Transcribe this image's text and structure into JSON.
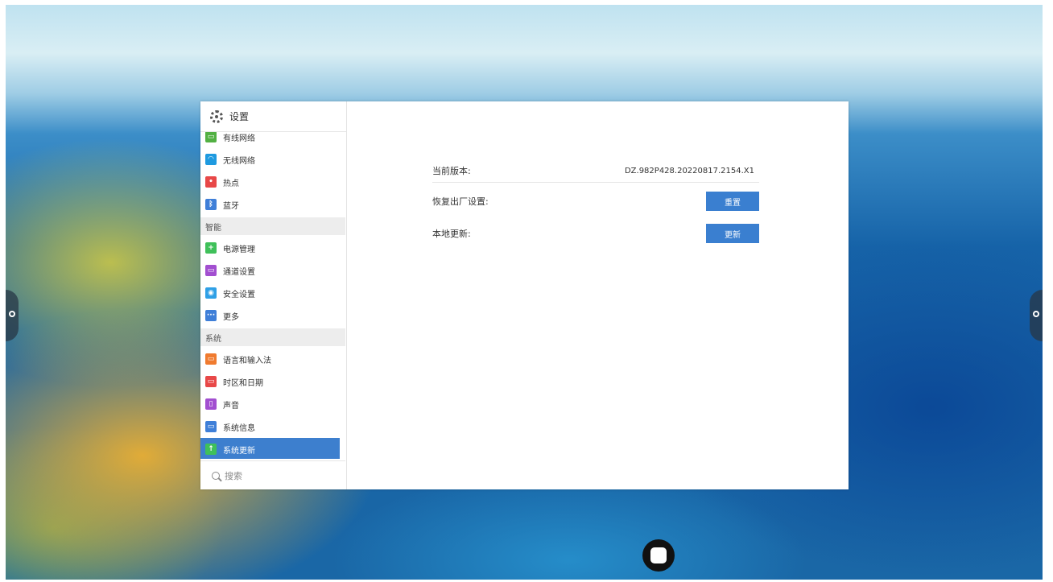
{
  "app": {
    "title": "设置"
  },
  "sidebar": {
    "items_top": [
      {
        "label": "有线网络",
        "icon": "wired-network-icon",
        "color": "#52b043",
        "glyph": "▭"
      },
      {
        "label": "无线网络",
        "icon": "wifi-icon",
        "color": "#1e9ae0",
        "glyph": "◠"
      },
      {
        "label": "热点",
        "icon": "hotspot-icon",
        "color": "#e84848",
        "glyph": "•"
      },
      {
        "label": "蓝牙",
        "icon": "bluetooth-icon",
        "color": "#3f7fd8",
        "glyph": "ᛒ"
      }
    ],
    "section_smart": "智能",
    "items_smart": [
      {
        "label": "电源管理",
        "icon": "power-management-icon",
        "color": "#3fc05a",
        "glyph": "+"
      },
      {
        "label": "通道设置",
        "icon": "channel-settings-icon",
        "color": "#a24fd0",
        "glyph": "▭"
      },
      {
        "label": "安全设置",
        "icon": "security-icon",
        "color": "#2fa0e6",
        "glyph": "◉"
      },
      {
        "label": "更多",
        "icon": "more-icon",
        "color": "#3f7fd8",
        "glyph": "···"
      }
    ],
    "section_system": "系统",
    "items_system": [
      {
        "label": "语言和输入法",
        "icon": "language-input-icon",
        "color": "#f07b2f",
        "glyph": "▭"
      },
      {
        "label": "时区和日期",
        "icon": "timezone-date-icon",
        "color": "#e84848",
        "glyph": "▭"
      },
      {
        "label": "声音",
        "icon": "sound-icon",
        "color": "#a24fd0",
        "glyph": "▯"
      },
      {
        "label": "系统信息",
        "icon": "system-info-icon",
        "color": "#3f7fd8",
        "glyph": "▭"
      },
      {
        "label": "系统更新",
        "icon": "system-update-icon",
        "color": "#3fc05a",
        "glyph": "↑"
      }
    ],
    "selected": "系统更新",
    "search": {
      "placeholder": "搜索"
    }
  },
  "main": {
    "version_label": "当前版本:",
    "version_value": "DZ.982P428.20220817.2154.X1",
    "reset_label": "恢复出厂设置:",
    "reset_button": "重置",
    "update_label": "本地更新:",
    "update_button": "更新"
  },
  "colors": {
    "accent": "#3a7fd0",
    "selected_bg": "#3d7fce"
  }
}
